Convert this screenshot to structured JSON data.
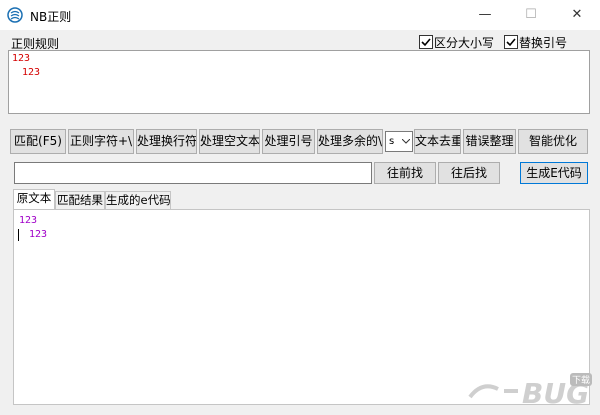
{
  "window": {
    "title": "NB正则",
    "minimize_glyph": "—",
    "maximize_glyph": "☐",
    "close_glyph": "✕"
  },
  "regex": {
    "label": "正则规则",
    "value": "123",
    "match_overlay": "123",
    "case_checkbox": {
      "label": "区分大小写",
      "checked": true
    },
    "quote_checkbox": {
      "label": "替换引号",
      "checked": true
    }
  },
  "toolbar": {
    "match": "匹配(F5)",
    "regex_char": "正则字符+\\",
    "handle_newline": "处理换行符",
    "handle_blank": "处理空文本",
    "handle_quote": "处理引号",
    "handle_extra": "处理多余的\\",
    "select_value": "s",
    "dedupe": "文本去重",
    "error_fix": "错误整理",
    "smart_opt": "智能优化"
  },
  "search": {
    "find_prev": "往前找",
    "find_next": "往后找",
    "gen_code": "生成E代码"
  },
  "tabs": [
    {
      "label": "原文本",
      "active": true
    },
    {
      "label": "匹配结果",
      "active": false
    },
    {
      "label": "生成的e代码",
      "active": false
    }
  ],
  "content": {
    "line1": "123",
    "line2": "123"
  },
  "watermark": {
    "text": "BUG",
    "small": "下载"
  },
  "colors": {
    "regex_red": "#d40000",
    "content_purple": "#a000c8",
    "checkbox_check": "#000000"
  },
  "icons": {
    "app": "app-logo-icon",
    "check": "check-icon",
    "dropdown": "chevron-down-icon"
  }
}
